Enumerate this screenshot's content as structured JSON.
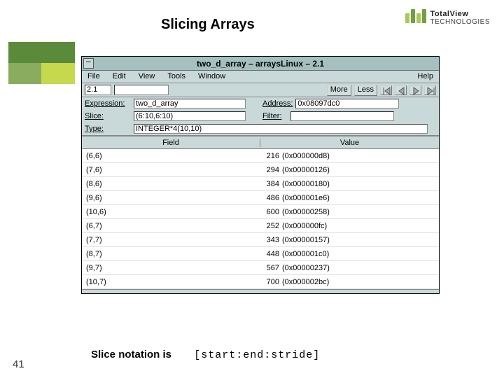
{
  "slide": {
    "title": "Slicing Arrays",
    "page_number": "41",
    "caption_prefix": "Slice notation is",
    "caption_code": "[start:end:stride]"
  },
  "brand": {
    "name_primary": "TotalView",
    "name_secondary": "TECHNOLOGIES"
  },
  "window": {
    "title": "two_d_array – arraysLinux – 2.1",
    "menus": {
      "file": "File",
      "edit": "Edit",
      "view": "View",
      "tools": "Tools",
      "window": "Window",
      "help": "Help"
    },
    "nav_value": "2.1",
    "more": "More",
    "less": "Less",
    "labels": {
      "expression": "Expression:",
      "address": "Address:",
      "slice": "Slice:",
      "filter": "Filter:",
      "type": "Type:"
    },
    "expression_val": "two_d_array",
    "address_val": "0x08097dc0",
    "slice_val": "(6:10,6:10)",
    "filter_val": "",
    "type_val": "INTEGER*4(10,10)",
    "col_field": "Field",
    "col_value": "Value",
    "rows": [
      {
        "field": "(6,6)",
        "num": "216",
        "hex": "(0x000000d8)"
      },
      {
        "field": "(7,6)",
        "num": "294",
        "hex": "(0x00000126)"
      },
      {
        "field": "(8,6)",
        "num": "384",
        "hex": "(0x00000180)"
      },
      {
        "field": "(9,6)",
        "num": "486",
        "hex": "(0x000001e6)"
      },
      {
        "field": "(10,6)",
        "num": "600",
        "hex": "(0x00000258)"
      },
      {
        "field": "(6,7)",
        "num": "252",
        "hex": "(0x000000fc)"
      },
      {
        "field": "(7,7)",
        "num": "343",
        "hex": "(0x00000157)"
      },
      {
        "field": "(8,7)",
        "num": "448",
        "hex": "(0x000001c0)"
      },
      {
        "field": "(9,7)",
        "num": "567",
        "hex": "(0x00000237)"
      },
      {
        "field": "(10,7)",
        "num": "700",
        "hex": "(0x000002bc)"
      }
    ]
  }
}
